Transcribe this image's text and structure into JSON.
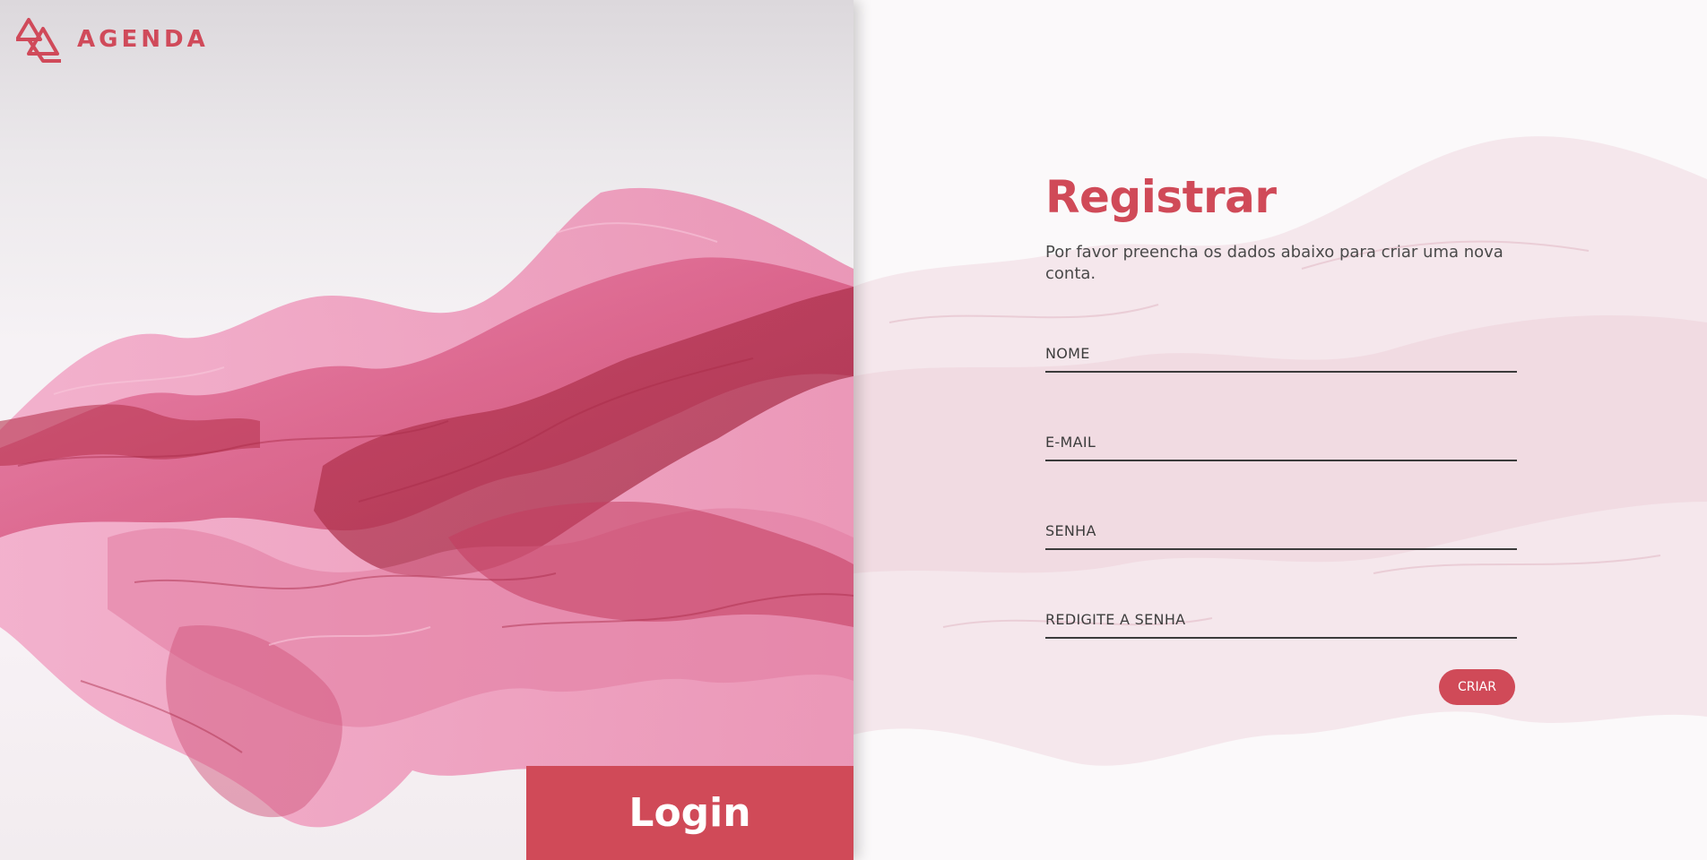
{
  "brand": {
    "name": "AGENDA",
    "icon": "triangles-logo-icon",
    "color": "#d04a5a"
  },
  "hero": {
    "image": "pink-silk-fabric-illustration",
    "login_label": "Login"
  },
  "form": {
    "title": "Registrar",
    "subtitle": "Por favor preencha os dados abaixo para criar uma nova conta.",
    "fields": [
      {
        "placeholder": "NOME",
        "value": ""
      },
      {
        "placeholder": "E-MAIL",
        "value": ""
      },
      {
        "placeholder": "SENHA",
        "value": ""
      },
      {
        "placeholder": "REDIGITE A SENHA",
        "value": ""
      }
    ],
    "submit_label": "CRIAR"
  },
  "colors": {
    "accent": "#d04a58",
    "text": "#4a4a4a",
    "background": "#fbf9fa"
  }
}
